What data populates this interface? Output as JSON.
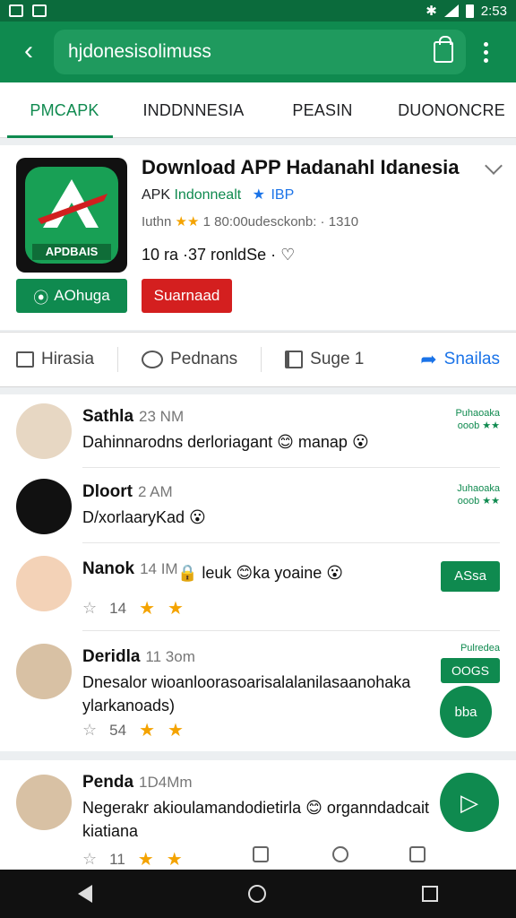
{
  "status_bar": {
    "time": "2:53"
  },
  "search": {
    "query": "hjdonesisolimuss"
  },
  "tabs": [
    {
      "label": "PMCAPK",
      "active": true
    },
    {
      "label": "INDDNNESIA"
    },
    {
      "label": "PEASIN"
    },
    {
      "label": "DUONONCRE"
    }
  ],
  "app": {
    "title": "Download APP Hadanahl Idanesia",
    "dev_prefix": "APK",
    "dev_name": "Indonnealt",
    "dev_star": "★",
    "dev_badge": "IBP",
    "rating_prefix": "Iuthn",
    "rating_stars": "★★",
    "rating_meta": "1 80:00udesckonb: · 1310",
    "installs": "10 ra ·37 ronldSe · ♡",
    "icon_text": "APDBAIS",
    "primary_button": "AOhuga",
    "secondary_button": "Suarnaad"
  },
  "actions": [
    "Hirasia",
    "Pednans",
    "Suge 1",
    "Snailas"
  ],
  "items": [
    {
      "name": "Sathla",
      "time": "23 NM",
      "text": "Dahinnarodns derloriagant 😊 manap 😮"
    },
    {
      "name": "Dloort",
      "time": "2 AM",
      "text": "D/xorlaaryKad 😮"
    },
    {
      "name": "Nanok",
      "time": "14 IM",
      "text": "🔒 leuk 😊ka yoaine 😮",
      "count": "14"
    },
    {
      "name": "Deridla",
      "time": "11 3om",
      "text": "Dnesalor wioanloorasoarisalalanilasaanohaka ylarkanoads)",
      "count": "54"
    }
  ],
  "card2": {
    "name": "Penda",
    "time": "1D4Mm",
    "text": "Negerakr akioulamandodietirla 😊 organndadcait kiatiana",
    "count": "11"
  },
  "side_notes": [
    "Puhaoaka",
    "Juhaoaka",
    "Pulredea"
  ],
  "side_note_stars": "ooob ★★",
  "side_note_stars2": "ooob ★★",
  "mini_buttons": [
    "ASsa",
    "OOGS"
  ],
  "fab_small": "bba",
  "icon_names": [
    "back-icon",
    "bag-icon",
    "more-icon",
    "shield-icon",
    "comment-icon",
    "book-icon",
    "share-icon",
    "play-icon"
  ]
}
